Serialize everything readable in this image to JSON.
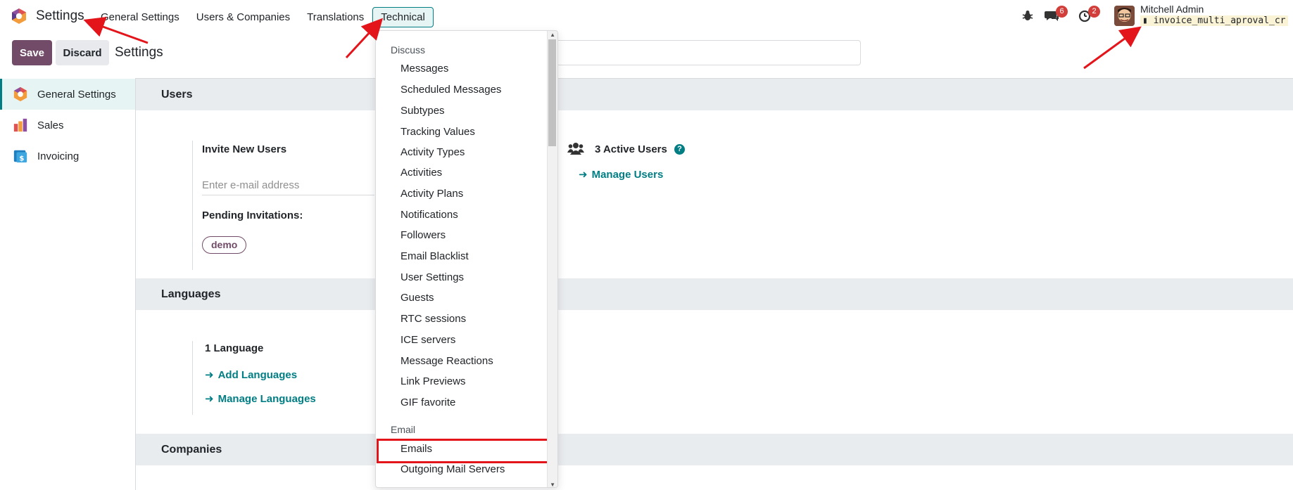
{
  "navbar": {
    "app_title": "Settings",
    "menu": [
      "General Settings",
      "Users & Companies",
      "Translations",
      "Technical"
    ],
    "chat_badge": "6",
    "activity_badge": "2",
    "user_name": "Mitchell Admin",
    "db_name": "invoice_multi_aproval_cr"
  },
  "control": {
    "save_label": "Save",
    "discard_label": "Discard",
    "breadcrumb": "Settings"
  },
  "sidebar": {
    "items": [
      {
        "label": "General Settings",
        "icon": "settings-app-icon"
      },
      {
        "label": "Sales",
        "icon": "sales-app-icon"
      },
      {
        "label": "Invoicing",
        "icon": "invoicing-app-icon"
      }
    ]
  },
  "main": {
    "users": {
      "title": "Users",
      "invite_label": "Invite New Users",
      "email_placeholder": "Enter e-mail address",
      "pending_label": "Pending Invitations:",
      "pending_user": "demo",
      "active_users": "3 Active Users",
      "manage_users": "Manage Users"
    },
    "languages": {
      "title": "Languages",
      "count": "1 Language",
      "add_languages": "Add Languages",
      "manage_languages": "Manage Languages"
    },
    "companies": {
      "title": "Companies"
    }
  },
  "dropdown": {
    "discuss_header": "Discuss",
    "discuss_items": [
      "Messages",
      "Scheduled Messages",
      "Subtypes",
      "Tracking Values",
      "Activity Types",
      "Activities",
      "Activity Plans",
      "Notifications",
      "Followers",
      "Email Blacklist",
      "User Settings",
      "Guests",
      "RTC sessions",
      "ICE servers",
      "Message Reactions",
      "Link Previews",
      "GIF favorite"
    ],
    "email_header": "Email",
    "email_items": [
      "Emails",
      "Outgoing Mail Servers"
    ],
    "highlighted_item": "Emails"
  },
  "colors": {
    "brand": "#714b67",
    "accent": "#017e84",
    "annotation": "#e4141b"
  }
}
